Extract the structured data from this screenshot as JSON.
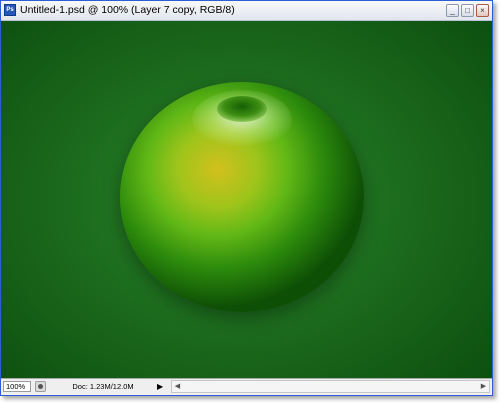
{
  "window": {
    "title": "Untitled-1.psd @ 100% (Layer 7 copy, RGB/8)",
    "app_icon_text": "Ps",
    "minimize_glyph": "_",
    "maximize_glyph": "□",
    "close_glyph": "×"
  },
  "statusbar": {
    "zoom": "100%",
    "doc_info": "Doc: 1.23M/12.0M",
    "arrow_glyph": "▶",
    "scroll_left_glyph": "◀",
    "scroll_right_glyph": "▶"
  },
  "icons": {
    "app": "photoshop-app-icon",
    "minimize": "minimize-icon",
    "maximize": "maximize-icon",
    "close": "close-icon",
    "navigator": "navigator-icon",
    "status_menu": "status-menu-arrow-icon"
  },
  "colors": {
    "canvas_background": "#1d6d1e",
    "apple_green": "#62b816",
    "apple_highlight": "#d3c01c"
  }
}
